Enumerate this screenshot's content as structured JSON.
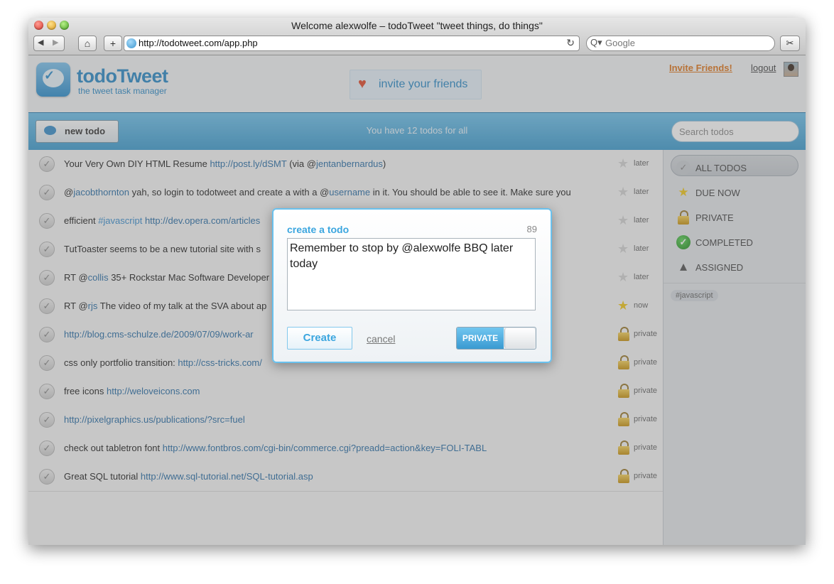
{
  "window": {
    "title": "Welcome alexwolfe – todoTweet \"tweet things, do things\""
  },
  "browser": {
    "back_icon": "◀",
    "forward_icon": "▶",
    "home_icon": "⌂",
    "add_icon": "+",
    "url": "http://todotweet.com/app.php",
    "reload_icon": "↻",
    "search_icon": "Q▾",
    "search_placeholder": "Google",
    "snip_icon": "✂"
  },
  "header": {
    "logo_name": "todoTweet",
    "logo_tagline": "the tweet task manager",
    "logo_check": "✓",
    "invite_box_label": "invite your friends",
    "heart_icon": "♥",
    "invite_link": "Invite Friends!",
    "logout_link": "logout"
  },
  "toolbar": {
    "new_todo_label": "new todo",
    "status_text": "You have 12 todos for all",
    "search_placeholder": "Search todos"
  },
  "todos": [
    {
      "segments": [
        {
          "t": "text",
          "v": "Your Very Own DIY HTML Resume "
        },
        {
          "t": "lnk",
          "v": "http://post.ly/dSMT"
        },
        {
          "t": "text",
          "v": " (via @"
        },
        {
          "t": "lnk",
          "v": "jentanbernardus"
        },
        {
          "t": "text",
          "v": ")"
        }
      ],
      "icon": "star-off",
      "when": "later"
    },
    {
      "segments": [
        {
          "t": "text",
          "v": "@"
        },
        {
          "t": "lnk",
          "v": "jacobthornton"
        },
        {
          "t": "text",
          "v": " yah, so login to todotweet and create a with a @"
        },
        {
          "t": "lnk",
          "v": "username"
        },
        {
          "t": "text",
          "v": " in it. You should be able to see it. Make sure you"
        }
      ],
      "icon": "star-off",
      "when": "later"
    },
    {
      "segments": [
        {
          "t": "text",
          "v": "efficient "
        },
        {
          "t": "tag",
          "v": "#javascript"
        },
        {
          "t": "text",
          "v": " "
        },
        {
          "t": "lnk",
          "v": "http://dev.opera.com/articles"
        }
      ],
      "icon": "star-off",
      "when": "later"
    },
    {
      "segments": [
        {
          "t": "text",
          "v": "TutToaster seems to be a new tutorial site with s"
        }
      ],
      "icon": "star-off",
      "when": "later"
    },
    {
      "segments": [
        {
          "t": "text",
          "v": "RT @"
        },
        {
          "t": "lnk",
          "v": "collis"
        },
        {
          "t": "text",
          "v": " 35+ Rockstar Mac Software Developer"
        }
      ],
      "icon": "star-off",
      "when": "later"
    },
    {
      "segments": [
        {
          "t": "text",
          "v": "RT @"
        },
        {
          "t": "lnk",
          "v": "rjs"
        },
        {
          "t": "text",
          "v": " The video of my talk at the SVA about ap"
        }
      ],
      "icon": "star-on",
      "when": "now"
    },
    {
      "segments": [
        {
          "t": "lnk",
          "v": "http://blog.cms-schulze.de/2009/07/09/work-ar"
        }
      ],
      "icon": "lock",
      "when": "private"
    },
    {
      "segments": [
        {
          "t": "text",
          "v": "css only portfolio transition: "
        },
        {
          "t": "lnk",
          "v": "http://css-tricks.com/"
        }
      ],
      "icon": "lock",
      "when": "private"
    },
    {
      "segments": [
        {
          "t": "text",
          "v": "free icons "
        },
        {
          "t": "lnk",
          "v": "http://weloveicons.com"
        }
      ],
      "icon": "lock",
      "when": "private"
    },
    {
      "segments": [
        {
          "t": "lnk",
          "v": "http://pixelgraphics.us/publications/?src=fuel"
        }
      ],
      "icon": "lock",
      "when": "private"
    },
    {
      "segments": [
        {
          "t": "text",
          "v": "check out tabletron font "
        },
        {
          "t": "lnk",
          "v": "http://www.fontbros.com/cgi-bin/commerce.cgi?preadd=action&key=FOLI-TABL"
        }
      ],
      "icon": "lock",
      "when": "private"
    },
    {
      "segments": [
        {
          "t": "text",
          "v": "Great SQL tutorial "
        },
        {
          "t": "lnk",
          "v": "http://www.sql-tutorial.net/SQL-tutorial.asp"
        }
      ],
      "icon": "lock",
      "when": "private"
    }
  ],
  "sidebar": {
    "items": [
      {
        "label": "ALL TODOS",
        "icon": "all-todos-icon",
        "glyph": "✓"
      },
      {
        "label": "DUE NOW",
        "icon": "star-icon",
        "glyph": "★"
      },
      {
        "label": "PRIVATE",
        "icon": "lock-icon",
        "glyph": ""
      },
      {
        "label": "COMPLETED",
        "icon": "check-icon",
        "glyph": "✓"
      },
      {
        "label": "ASSIGNED",
        "icon": "user-icon",
        "glyph": "▲"
      }
    ],
    "tag": "#javascript"
  },
  "dialog": {
    "title": "create a todo",
    "char_count": "89",
    "input_value": "Remember to stop by @alexwolfe BBQ later today",
    "create_label": "Create",
    "cancel_label": "cancel",
    "toggle_label": "PRIVATE"
  }
}
